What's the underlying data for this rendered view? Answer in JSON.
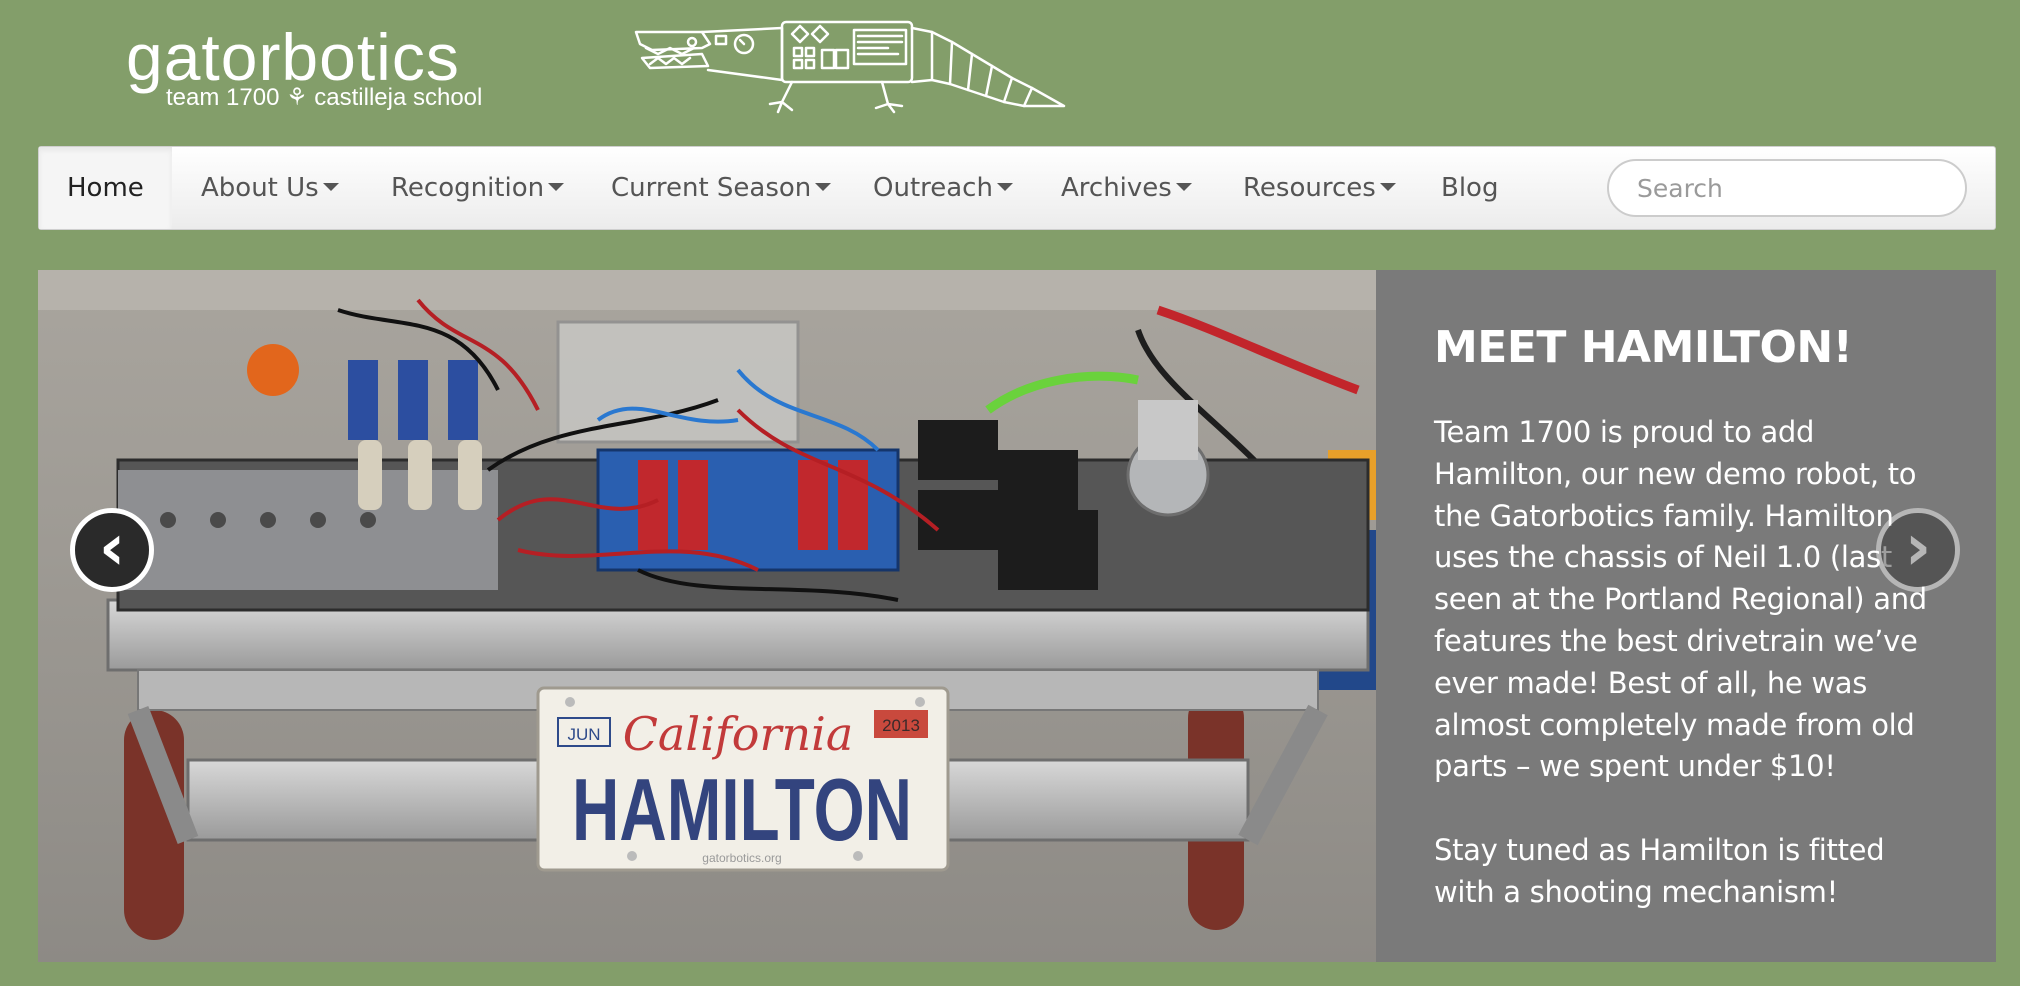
{
  "brand": {
    "title": "gatorbotics",
    "subtitle": "team 1700 ⚘ castilleja school",
    "mascot_icon": "robot-alligator-icon"
  },
  "nav": {
    "items": [
      {
        "label": "Home",
        "dropdown": false,
        "active": true
      },
      {
        "label": "About Us",
        "dropdown": true
      },
      {
        "label": "Recognition",
        "dropdown": true
      },
      {
        "label": "Current Season",
        "dropdown": true
      },
      {
        "label": "Outreach",
        "dropdown": true
      },
      {
        "label": "Archives",
        "dropdown": true
      },
      {
        "label": "Resources",
        "dropdown": true
      },
      {
        "label": "Blog",
        "dropdown": false
      }
    ],
    "search_placeholder": "Search"
  },
  "slide": {
    "title": "MEET HAMILTON!",
    "paragraphs": [
      "Team 1700 is proud to add Hamilton, our new demo robot, to the Gatorbotics family. Hamilton uses the chassis of Neil 1.0 (last seen at the Portland Regional) and features the best drivetrain we’ve ever made! Best of all, he was almost completely made from old parts – we spent under $10!",
      "Stay tuned as Hamilton is fitted with a shooting mechanism!"
    ],
    "image_alt": "Hamilton robot with California license plate",
    "plate": {
      "month": "JUN",
      "state": "California",
      "year": "2013",
      "name": "HAMILTON",
      "url": "gatorbotics.org"
    },
    "prev_icon": "chevron-left-icon",
    "next_icon": "chevron-right-icon",
    "prev_glyph": "‹",
    "next_glyph": "›"
  },
  "colors": {
    "page_bg": "#839e6a",
    "caption_bg": "#7a7a7a"
  }
}
